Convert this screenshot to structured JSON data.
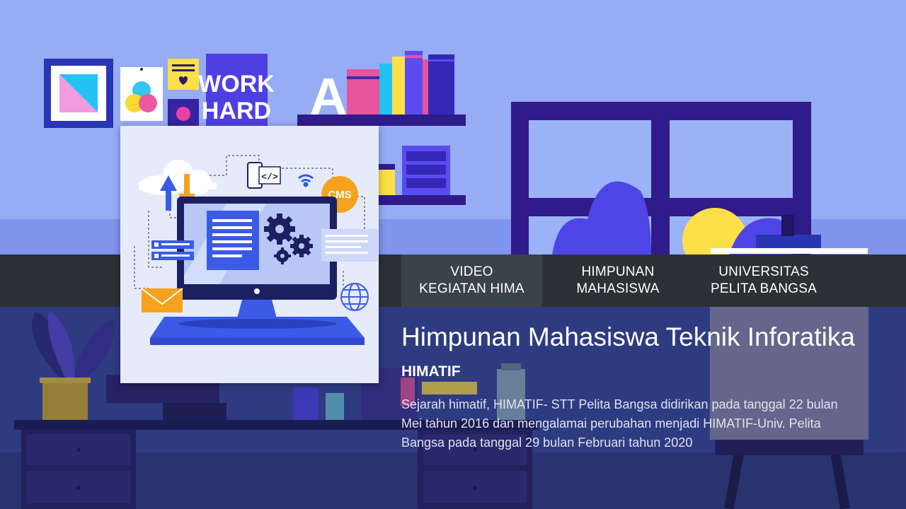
{
  "nav": {
    "video": "VIDEO\nKEGIATAN HIMA",
    "himpunan": "HIMPUNAN\nMAHASISWA",
    "universitas": "UNIVERSITAS\nPELITA BANGSA"
  },
  "poster": {
    "work_hard_line1": "WORK",
    "work_hard_line2": "HARD",
    "letter": "A"
  },
  "thumbnail": {
    "badge": "CMS",
    "code_symbol": "</>"
  },
  "hero": {
    "title": "Himpunan Mahasiswa Teknik Inforatika",
    "subtitle": "HIMATIF",
    "description": "Sejarah himatif, HIMATIF- STT Pelita Bangsa didirikan pada tanggal 22 bulan Mei tahun 2016 dan mengalamai perubahan menjadi HIMATIF-Univ. Pelita Bangsa pada tanggal 29 bulan Februari tahun 2020"
  },
  "colors": {
    "wall": "#96acf4",
    "navbar": "#2b3236",
    "accent_purple": "#2f1b8a",
    "accent_yellow": "#fde047",
    "accent_pink": "#e6549b"
  },
  "icons": [
    "cloud-icon",
    "monitor-icon",
    "gear-icon",
    "envelope-icon",
    "globe-icon",
    "wifi-icon",
    "code-icon",
    "upload-arrow-icon",
    "download-arrow-icon"
  ]
}
